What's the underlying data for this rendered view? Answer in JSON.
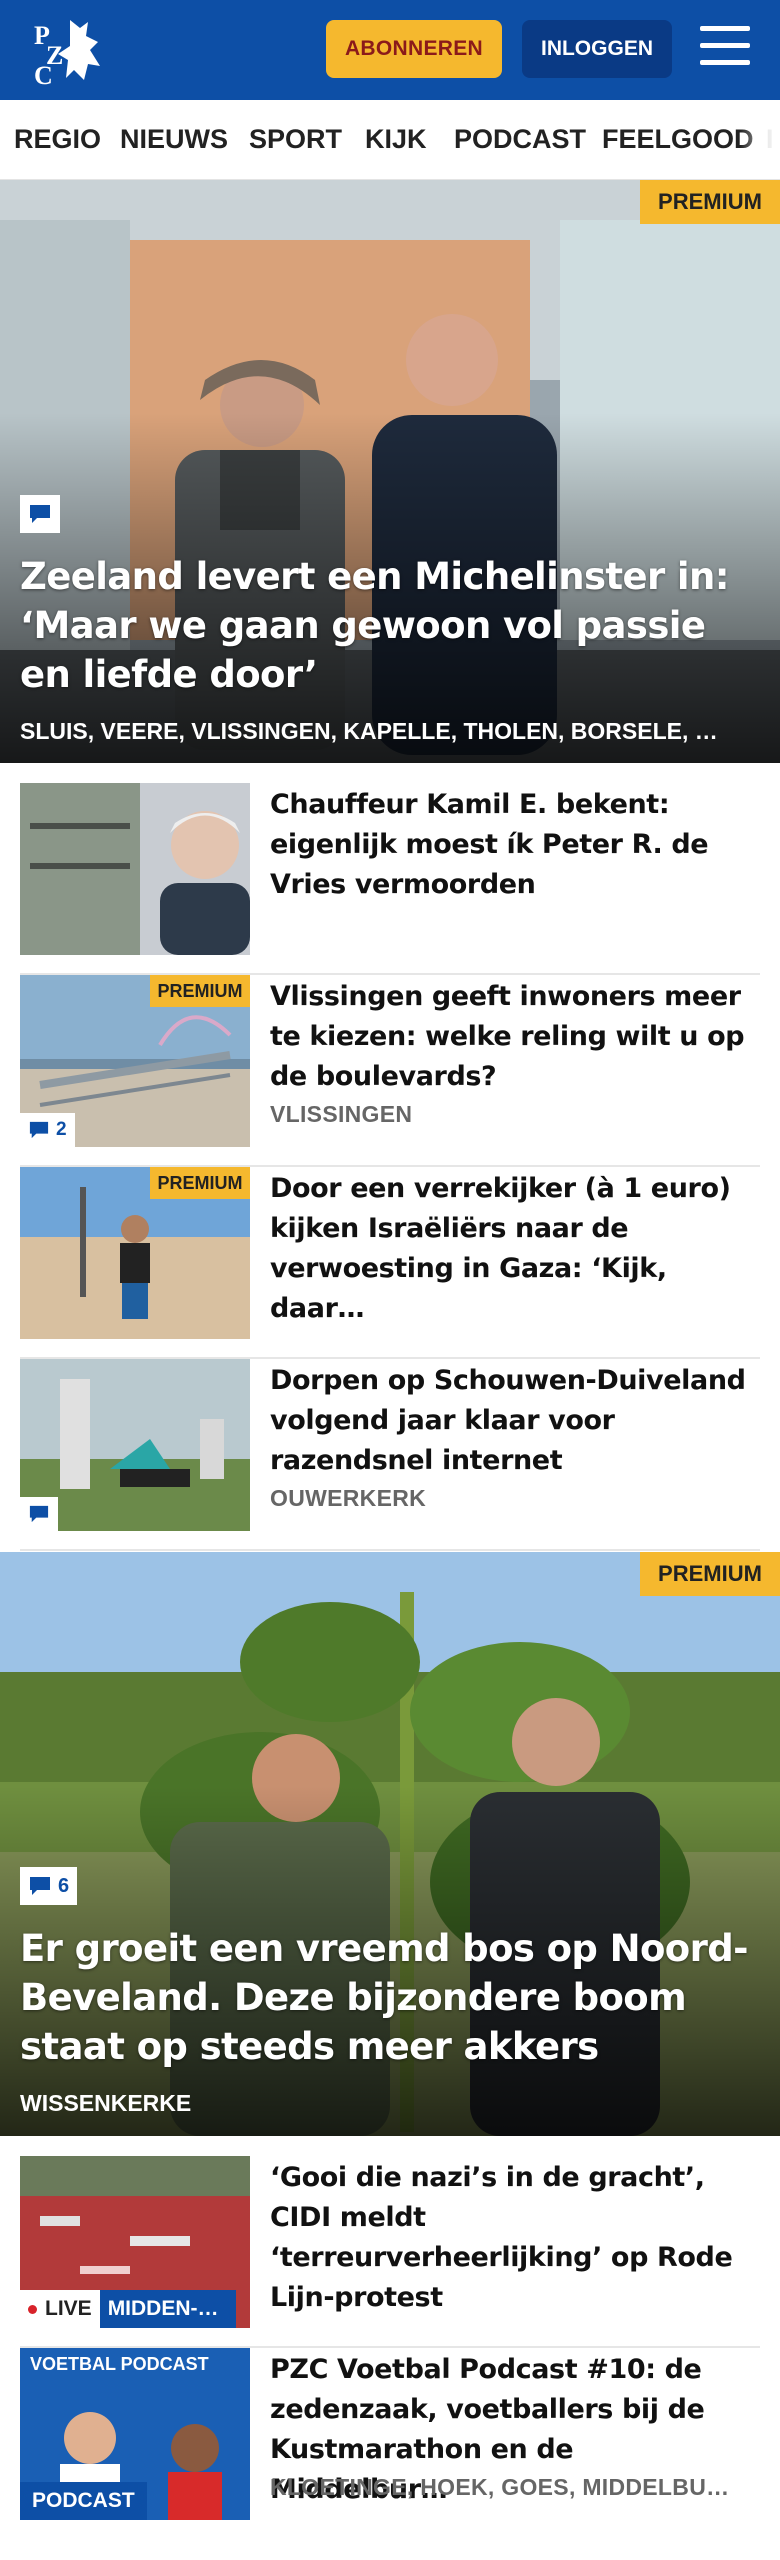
{
  "header": {
    "logo_text": "PZC",
    "subscribe_label": "ABONNEREN",
    "login_label": "INLOGGEN",
    "menu_icon": "hamburger-menu-icon"
  },
  "nav": {
    "items": [
      "REGIO",
      "NIEUWS",
      "SPORT",
      "KIJK",
      "PODCAST",
      "FEELGOOD",
      "I"
    ]
  },
  "hero1": {
    "badge": "PREMIUM",
    "comment_icon": "comment-icon",
    "title": "Zeeland levert een Michelinster in: ‘Maar we gaan gewoon vol passie en liefde door’",
    "locations": "SLUIS, VEERE, VLISSINGEN, KAPELLE, THOLEN, BORSELE, …"
  },
  "articles": [
    {
      "title": "Chauffeur Kamil E. bekent: eigenlijk moest ík Peter R. de Vries vermoorden",
      "location": "",
      "badge": "",
      "comments": ""
    },
    {
      "title": "Vlissingen geeft inwoners meer te kiezen: welke reling wilt u op de boulevards?",
      "location": "VLISSINGEN",
      "badge": "PREMIUM",
      "comments": "2"
    },
    {
      "title": "Door een verrekijker (à 1 euro) kijken Israëliërs naar de verwoesting in Gaza: ‘Kijk, daar…",
      "location": "",
      "badge": "PREMIUM",
      "comments": ""
    },
    {
      "title": "Dorpen op Schouwen-Duiveland volgend jaar klaar voor razendsnel internet",
      "location": "OUWERKERK",
      "badge": "",
      "comments": ""
    }
  ],
  "hero2": {
    "badge": "PREMIUM",
    "comments": "6",
    "title": "Er groeit een vreemd bos op Noord-Beveland. Deze bijzondere boom staat op steeds meer akkers",
    "location": "WISSENKERKE"
  },
  "articles2": [
    {
      "title": "‘Gooi die nazi’s in de gracht’, CIDI meldt ‘terreurverheerlijking’ op Rode Lijn-protest",
      "live_label": "LIVE",
      "live_tag": "MIDDEN-…"
    },
    {
      "title": "PZC Voetbal Podcast #10: de zedenzaak, voetballers bij de Kustmarathon en de Middelbur…",
      "location": "KLOETINGE, HOEK, GOES, MIDDELBU…",
      "tag": "PODCAST",
      "thumb_text": "VOETBAL PODCAST"
    }
  ],
  "colors": {
    "brand_blue": "#0d4fa6",
    "premium_yellow": "#f5b82e",
    "live_red": "#d8232a"
  }
}
